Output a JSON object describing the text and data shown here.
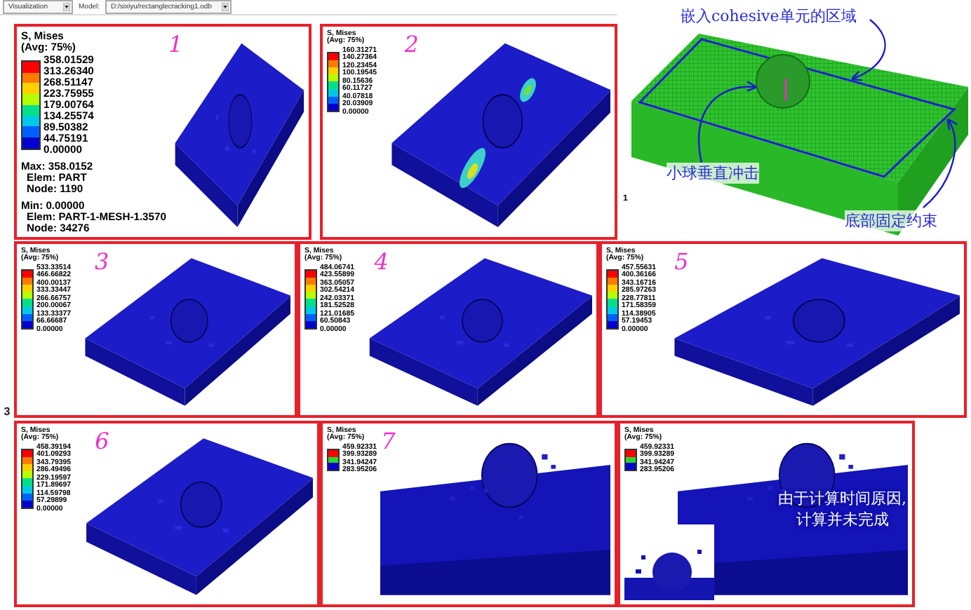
{
  "toolbar": {
    "module": "Visualization",
    "model_label": "Model:",
    "model": "D:/sixiyu/rectanglecracking1.odb"
  },
  "frame_mark": "3",
  "rows": [
    {
      "panels": [
        {
          "kind": "plate",
          "number": "1",
          "legend": {
            "title": "S, Mises",
            "average": "(Avg: 75%)",
            "values": [
              "358.01529",
              "313.26340",
              "268.51147",
              "223.75955",
              "179.00764",
              "134.25574",
              "89.50382",
              "44.75191",
              "0.00000"
            ]
          },
          "info": [
            "Max: 358.0152",
            "Elem: PART",
            "Node: 1190",
            "Min: 0.00000",
            "Elem: PART-1-MESH-1.3570",
            "Node: 34276"
          ]
        },
        {
          "kind": "streaks",
          "number": "2",
          "legend": {
            "title": "S, Mises",
            "average": "(Avg: 75%)",
            "values": [
              "160.31271",
              "140.27364",
              "120.23454",
              "100.19545",
              "80.15636",
              "60.11727",
              "40.07818",
              "20.03909",
              "0.00000"
            ]
          }
        },
        {
          "kind": "mesh",
          "corner_mark": "1",
          "annotations": [
            "嵌入cohesive单元的区域",
            "小球垂直冲击",
            "底部固定约束"
          ]
        }
      ]
    },
    {
      "panels": [
        {
          "kind": "plate",
          "number": "3",
          "legend": {
            "title": "S, Mises",
            "average": "(Avg: 75%)",
            "values": [
              "533.33514",
              "466.66822",
              "400.00137",
              "333.33447",
              "266.66757",
              "200.00067",
              "133.33377",
              "66.66687",
              "0.00000"
            ]
          }
        },
        {
          "kind": "plate",
          "number": "4",
          "legend": {
            "title": "S, Mises",
            "average": "(Avg: 75%)",
            "values": [
              "484.06741",
              "423.55899",
              "363.05057",
              "302.54214",
              "242.03371",
              "181.52528",
              "121.01685",
              "60.50843",
              "0.00000"
            ]
          }
        },
        {
          "kind": "plate",
          "number": "5",
          "legend": {
            "title": "S, Mises",
            "average": "(Avg: 75%)",
            "values": [
              "457.55631",
              "400.36166",
              "343.16716",
              "285.97263",
              "228.77811",
              "171.58359",
              "114.38905",
              "57.19453",
              "0.00000"
            ]
          }
        }
      ]
    },
    {
      "panels": [
        {
          "kind": "plate",
          "number": "6",
          "legend": {
            "title": "S, Mises",
            "average": "(Avg: 75%)",
            "values": [
              "458.39194",
              "401.09293",
              "343.79395",
              "286.49496",
              "229.19597",
              "171.89697",
              "114.59798",
              "57.29899",
              "0.00000"
            ]
          }
        },
        {
          "kind": "closeup",
          "number": "7",
          "legend": {
            "title": "S, Mises",
            "average": "(Avg: 75%)",
            "values": [
              "459.92331",
              "399.93289",
              "341.94247",
              "283.95206"
            ]
          }
        },
        {
          "kind": "closeup",
          "legend": {
            "title": "S, Mises",
            "average": "(Avg: 75%)",
            "values": [
              "459.92331",
              "399.93289",
              "341.94247",
              "283.95206"
            ]
          },
          "note": [
            "由于计算时间原因,",
            "计算并未完成"
          ]
        }
      ]
    }
  ]
}
